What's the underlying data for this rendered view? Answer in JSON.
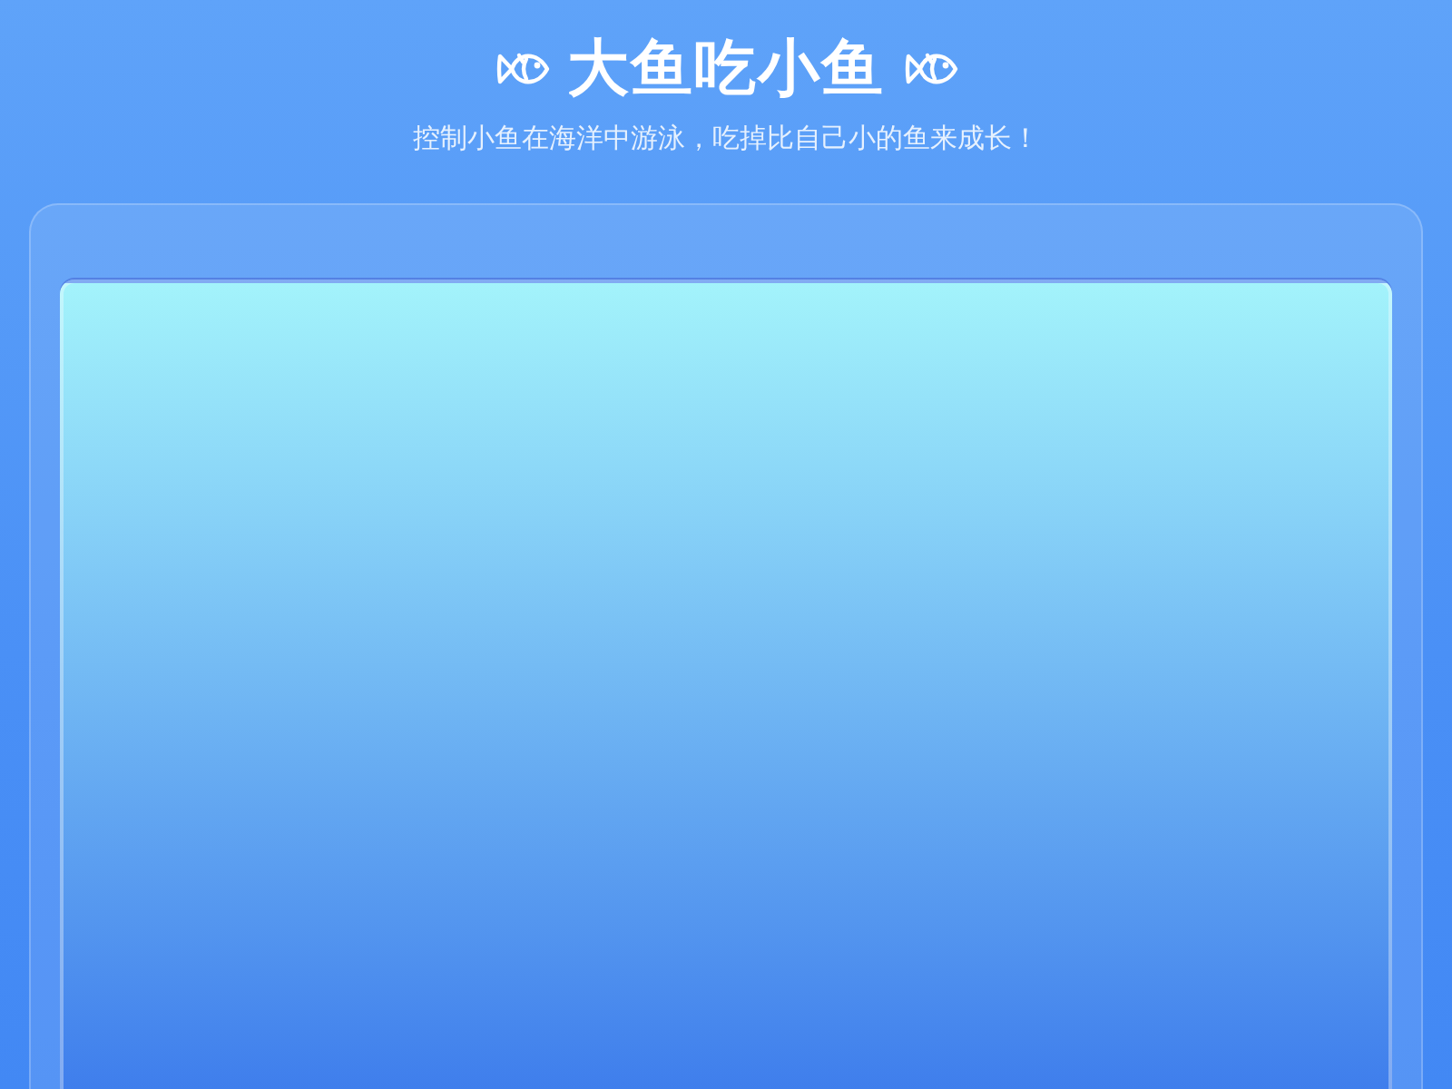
{
  "header": {
    "title": "大鱼吃小鱼",
    "subtitle": "控制小鱼在海洋中游泳，吃掉比自己小的鱼来成长！"
  }
}
